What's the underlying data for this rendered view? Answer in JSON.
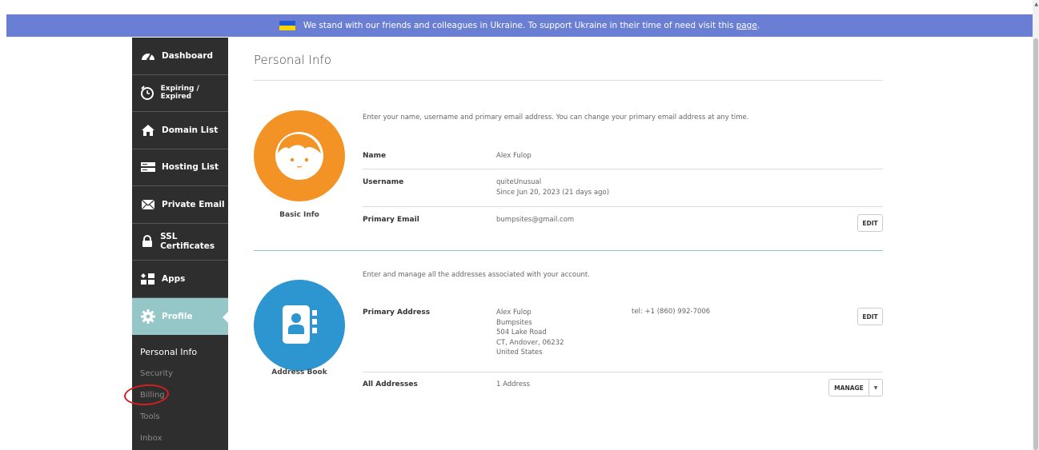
{
  "banner": {
    "text": "We stand with our friends and colleagues in Ukraine. To support Ukraine in their time of need visit this",
    "link": "page",
    "end": ".",
    "flag_colors": [
      "#1f5bd6",
      "#ffd500"
    ]
  },
  "sidebar": {
    "items": [
      {
        "label": "Dashboard",
        "icon": "gauge-icon"
      },
      {
        "label": "Expiring / Expired",
        "icon": "timer-icon"
      },
      {
        "label": "Domain List",
        "icon": "house-icon"
      },
      {
        "label": "Hosting List",
        "icon": "server-icon"
      },
      {
        "label": "Private Email",
        "icon": "envelope-icon"
      },
      {
        "label": "SSL Certificates",
        "icon": "lock-icon"
      },
      {
        "label": "Apps",
        "icon": "apps-icon"
      },
      {
        "label": "Profile",
        "icon": "gear-icon"
      }
    ],
    "subitems": [
      "Personal Info",
      "Security",
      "Billing",
      "Tools",
      "Inbox"
    ],
    "active_color": "#95c6c8"
  },
  "main": {
    "title": "Personal Info",
    "basic": {
      "label": "Basic Info",
      "description": "Enter your name, username and primary email address. You can change your primary email address at any time.",
      "name_label": "Name",
      "name_value": "Alex Fulop",
      "username_label": "Username",
      "username_value": "quiteUnusual",
      "username_since": "Since Jun 20, 2023 (21 days ago)",
      "email_label": "Primary Email",
      "email_value": "bumpsites@gmail.com",
      "edit_label": "EDIT"
    },
    "address": {
      "label": "Address Book",
      "description": "Enter and manage all the addresses associated with your account.",
      "primary_label": "Primary Address",
      "lines": [
        "Alex Fulop",
        "Bumpsites",
        "504 Lake Road",
        "CT, Andover, 06232",
        "United States"
      ],
      "phone": "tel: +1 (860) 992-7006",
      "edit_label": "EDIT",
      "all_label": "All Addresses",
      "all_value": "1 Address",
      "manage_label": "MANAGE"
    },
    "accent_orange": "#f39325",
    "accent_blue": "#2d95cf"
  }
}
